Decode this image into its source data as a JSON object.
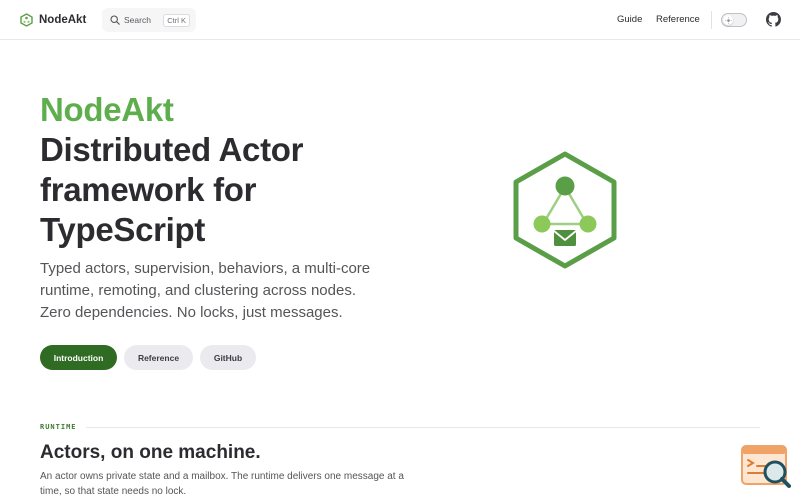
{
  "nav": {
    "brand": "NodeAkt",
    "search_label": "Search",
    "search_shortcut": "Ctrl K",
    "links": [
      "Guide",
      "Reference"
    ]
  },
  "hero": {
    "name": "NodeAkt",
    "title_lines": [
      "Distributed Actor",
      "framework for",
      "TypeScript"
    ],
    "tagline_lines": [
      "Typed actors, supervision, behaviors, a multi-core",
      "runtime, remoting, and clustering across nodes.",
      "Zero dependencies. No locks, just messages."
    ],
    "actions": [
      "Introduction",
      "Reference",
      "GitHub"
    ]
  },
  "runtime_section": {
    "eyebrow": "RUNTIME",
    "title": "Actors, on one machine.",
    "body_lines": [
      "An actor owns private state and a mailbox. The runtime delivers one message at a",
      "time, so that state needs no lock."
    ]
  },
  "colors": {
    "brand_green": "#5fae4d",
    "primary_button": "#2f6b22",
    "logo_hexagon": "#5a9e48",
    "logo_node_light": "#8dc95a",
    "widget_orange": "#f0a366"
  },
  "icons": [
    "hexagon-logo-icon",
    "search-icon",
    "sun-icon",
    "github-icon",
    "actor-graph-logo-icon",
    "search-document-icon"
  ]
}
